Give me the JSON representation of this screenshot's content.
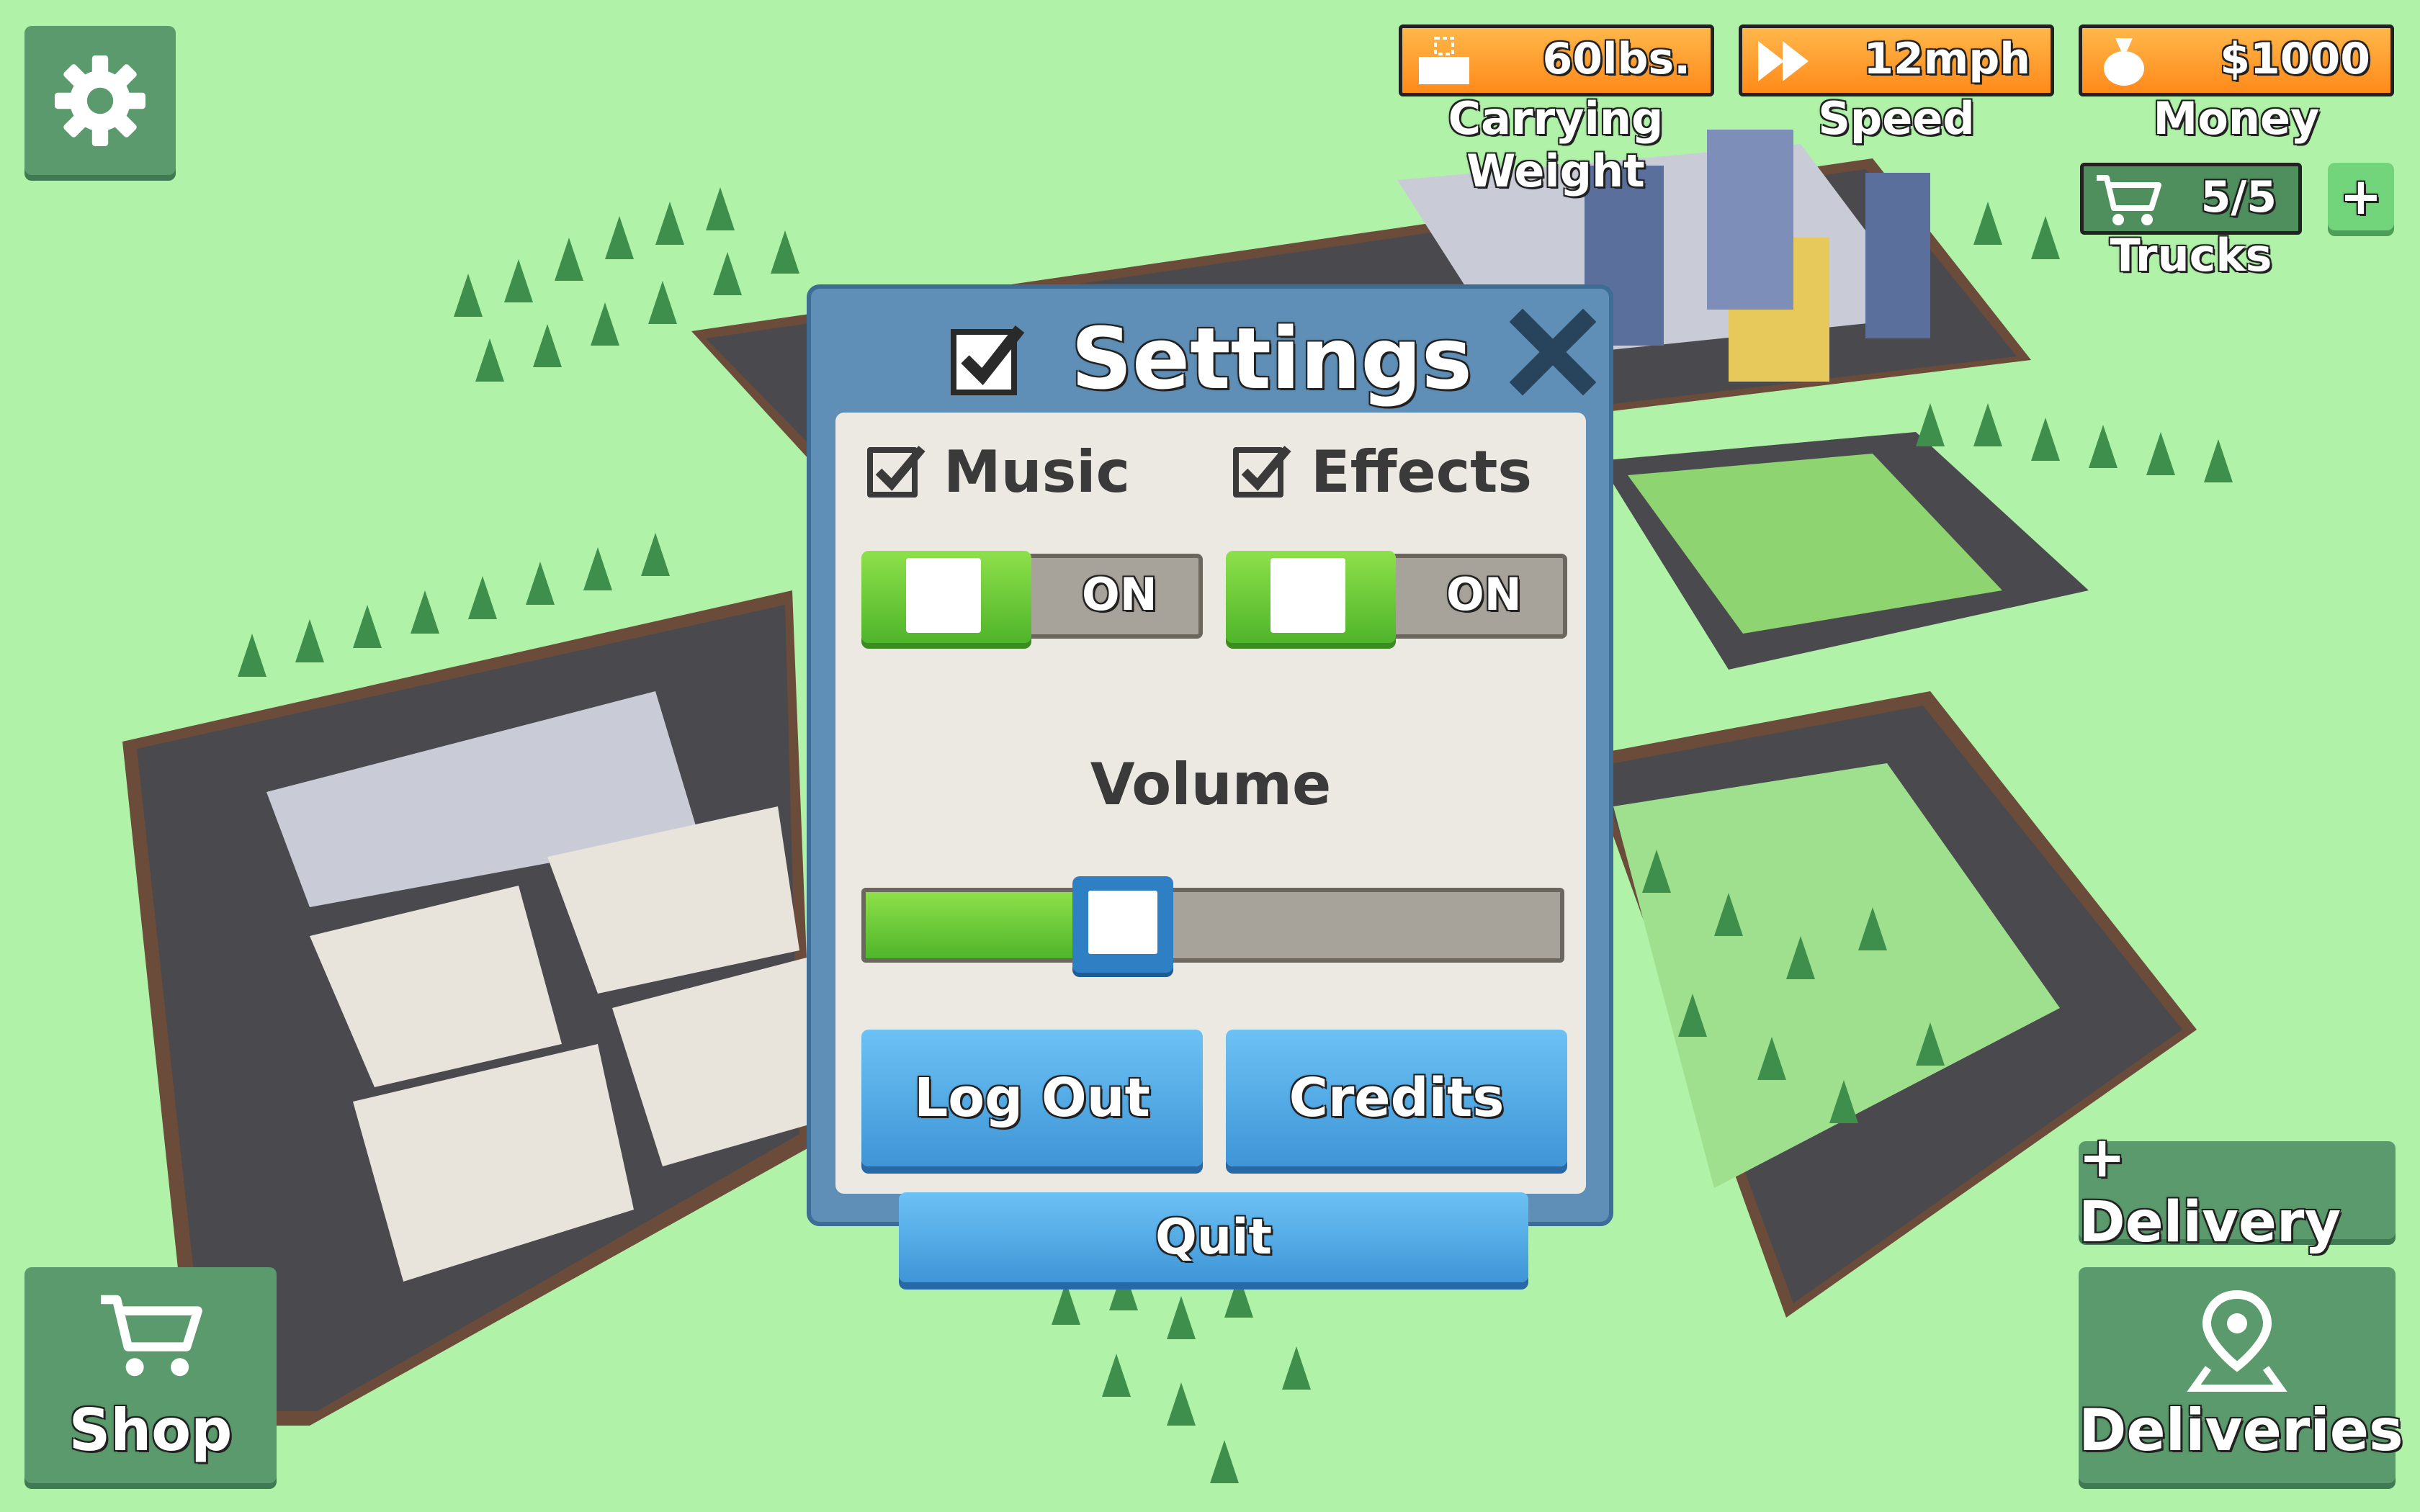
{
  "hud": {
    "carrying_weight": {
      "value": "60lbs.",
      "label": "Carrying Weight",
      "icon": "weight-box-icon"
    },
    "speed": {
      "value": "12mph",
      "label": "Speed",
      "icon": "fast-forward-icon"
    },
    "money": {
      "value": "$1000",
      "label": "Money",
      "icon": "money-bag-icon"
    },
    "trucks": {
      "value": "5/5",
      "label": "Trucks",
      "icon": "cart-icon"
    },
    "add_truck": "+"
  },
  "buttons": {
    "shop": "Shop",
    "add_delivery": "+ Delivery",
    "deliveries": "Deliveries"
  },
  "settings": {
    "title": "Settings",
    "music": {
      "label": "Music",
      "state": "ON",
      "checked": true
    },
    "effects": {
      "label": "Effects",
      "state": "ON",
      "checked": true
    },
    "volume": {
      "label": "Volume",
      "level": 0.37
    },
    "log_out": "Log Out",
    "credits": "Credits",
    "quit": "Quit"
  },
  "colors": {
    "ground": "#b0f2a8",
    "hud_orange": "#ff9a2a",
    "button_green": "#5b9a6c",
    "panel_blue": "#5f8fb6",
    "toggle_green": "#5cc232",
    "button_blue": "#4fa6e2"
  }
}
